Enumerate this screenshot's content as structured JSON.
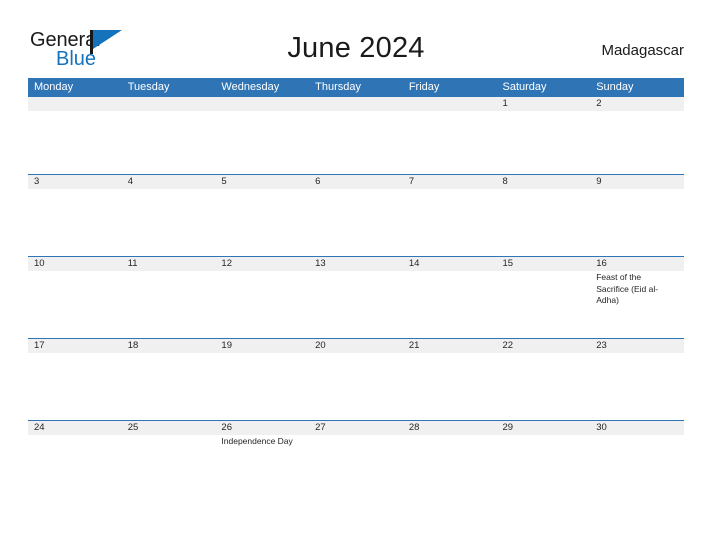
{
  "brand": {
    "name_part1": "General",
    "name_part2": "Blue",
    "flag_icon": "flag-icon"
  },
  "header": {
    "title": "June 2024",
    "country": "Madagascar"
  },
  "colors": {
    "header_blue": "#2f74b5",
    "band_gray": "#f0f0f0",
    "logo_blue": "#1573bc",
    "text": "#262626"
  },
  "calendar": {
    "weekdays": [
      "Monday",
      "Tuesday",
      "Wednesday",
      "Thursday",
      "Friday",
      "Saturday",
      "Sunday"
    ],
    "weeks": [
      {
        "days": [
          {
            "num": "",
            "event": ""
          },
          {
            "num": "",
            "event": ""
          },
          {
            "num": "",
            "event": ""
          },
          {
            "num": "",
            "event": ""
          },
          {
            "num": "",
            "event": ""
          },
          {
            "num": "1",
            "event": ""
          },
          {
            "num": "2",
            "event": ""
          }
        ]
      },
      {
        "days": [
          {
            "num": "3",
            "event": ""
          },
          {
            "num": "4",
            "event": ""
          },
          {
            "num": "5",
            "event": ""
          },
          {
            "num": "6",
            "event": ""
          },
          {
            "num": "7",
            "event": ""
          },
          {
            "num": "8",
            "event": ""
          },
          {
            "num": "9",
            "event": ""
          }
        ]
      },
      {
        "days": [
          {
            "num": "10",
            "event": ""
          },
          {
            "num": "11",
            "event": ""
          },
          {
            "num": "12",
            "event": ""
          },
          {
            "num": "13",
            "event": ""
          },
          {
            "num": "14",
            "event": ""
          },
          {
            "num": "15",
            "event": ""
          },
          {
            "num": "16",
            "event": "Feast of the Sacrifice (Eid al-Adha)"
          }
        ]
      },
      {
        "days": [
          {
            "num": "17",
            "event": ""
          },
          {
            "num": "18",
            "event": ""
          },
          {
            "num": "19",
            "event": ""
          },
          {
            "num": "20",
            "event": ""
          },
          {
            "num": "21",
            "event": ""
          },
          {
            "num": "22",
            "event": ""
          },
          {
            "num": "23",
            "event": ""
          }
        ]
      },
      {
        "days": [
          {
            "num": "24",
            "event": ""
          },
          {
            "num": "25",
            "event": ""
          },
          {
            "num": "26",
            "event": "Independence Day"
          },
          {
            "num": "27",
            "event": ""
          },
          {
            "num": "28",
            "event": ""
          },
          {
            "num": "29",
            "event": ""
          },
          {
            "num": "30",
            "event": ""
          }
        ]
      }
    ]
  }
}
